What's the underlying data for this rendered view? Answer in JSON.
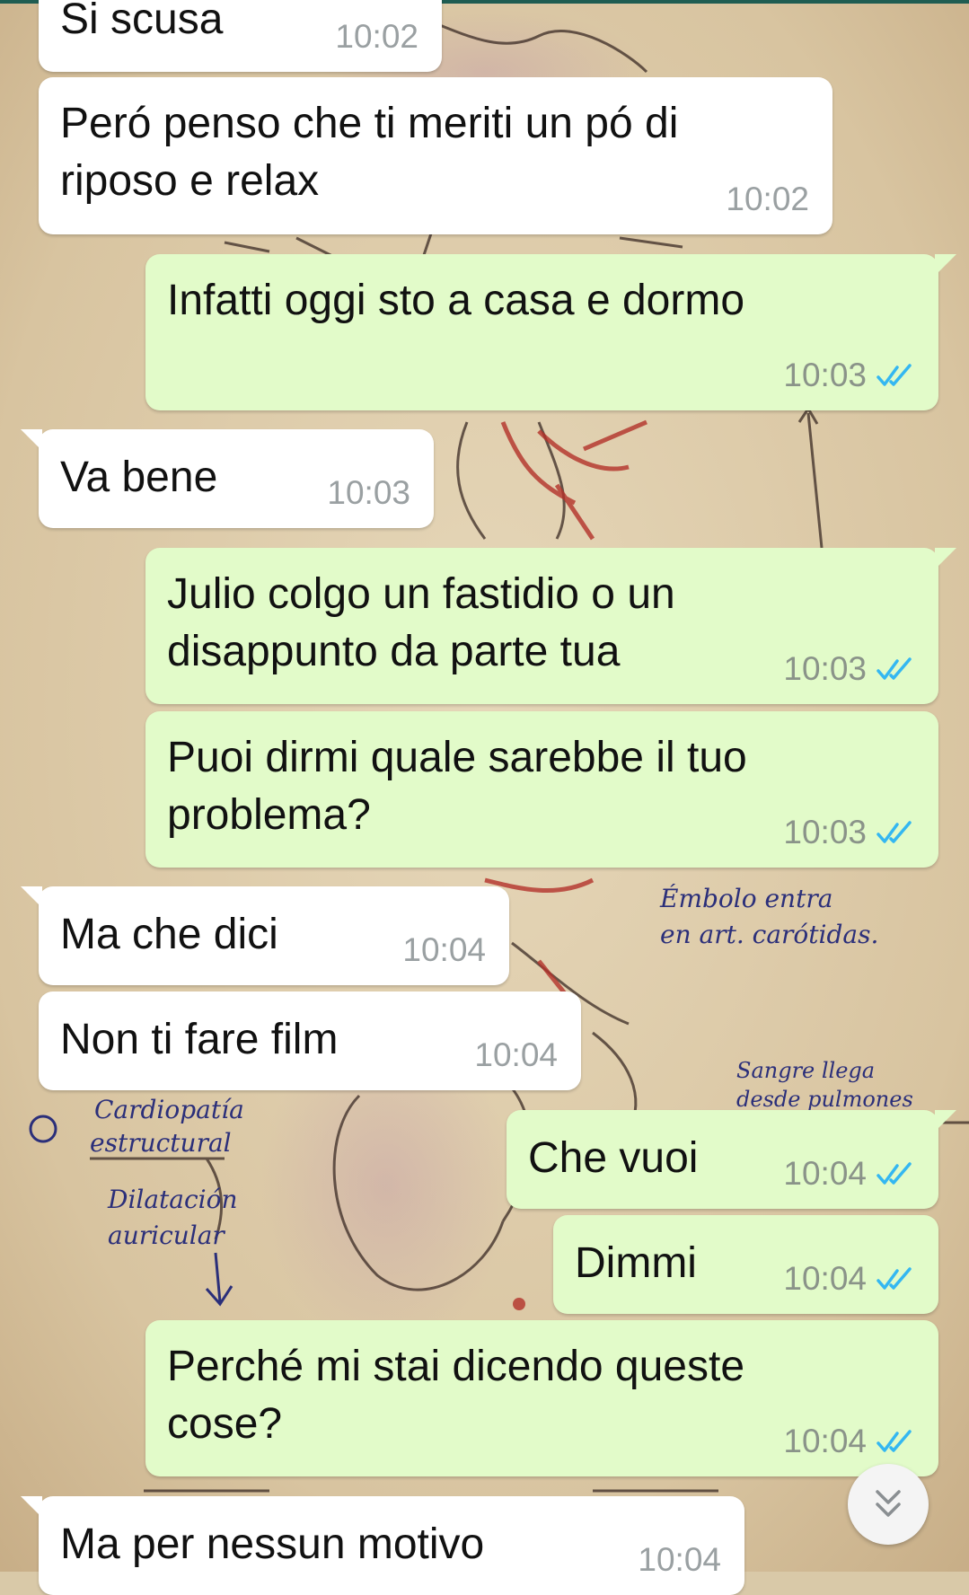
{
  "wallpaper_notes": {
    "note1": "Émbolo entra",
    "note2": "en art. carótidas.",
    "note3": "Sangre llega",
    "note4": "desde pulmones",
    "note5": "Cardiopatía",
    "note6": "estructural",
    "note7": "Dilatación",
    "note8": "auricular"
  },
  "messages": [
    {
      "dir": "in",
      "text": "Si scusa",
      "time": "10:02"
    },
    {
      "dir": "in",
      "text": "Peró penso che ti meriti un pó di\nriposo e relax",
      "time": "10:02"
    },
    {
      "dir": "out",
      "text": "Infatti oggi sto a casa e dormo",
      "time": "10:03",
      "status": "read"
    },
    {
      "dir": "in",
      "text": "Va bene",
      "time": "10:03"
    },
    {
      "dir": "out",
      "text": "Julio colgo un fastidio o un\ndisappunto da parte tua",
      "time": "10:03",
      "status": "read"
    },
    {
      "dir": "out",
      "text": "Puoi dirmi quale sarebbe il tuo\nproblema?",
      "time": "10:03",
      "status": "read"
    },
    {
      "dir": "in",
      "text": "Ma che dici",
      "time": "10:04"
    },
    {
      "dir": "in",
      "text": "Non ti fare film",
      "time": "10:04"
    },
    {
      "dir": "out",
      "text": "Che vuoi",
      "time": "10:04",
      "status": "read"
    },
    {
      "dir": "out",
      "text": "Dimmi",
      "time": "10:04",
      "status": "read"
    },
    {
      "dir": "out",
      "text": "Perché mi stai dicendo queste\ncose?",
      "time": "10:04",
      "status": "read"
    },
    {
      "dir": "in",
      "text": "Ma per nessun motivo",
      "time": "10:04"
    }
  ],
  "icons": {
    "read_receipt": "double-check-icon",
    "scroll_down": "double-chevron-down-icon"
  },
  "colors": {
    "incoming_bubble": "#ffffff",
    "outgoing_bubble": "#e2fbc9",
    "read_ticks": "#34b7f1",
    "timestamp": "#8a9389"
  }
}
